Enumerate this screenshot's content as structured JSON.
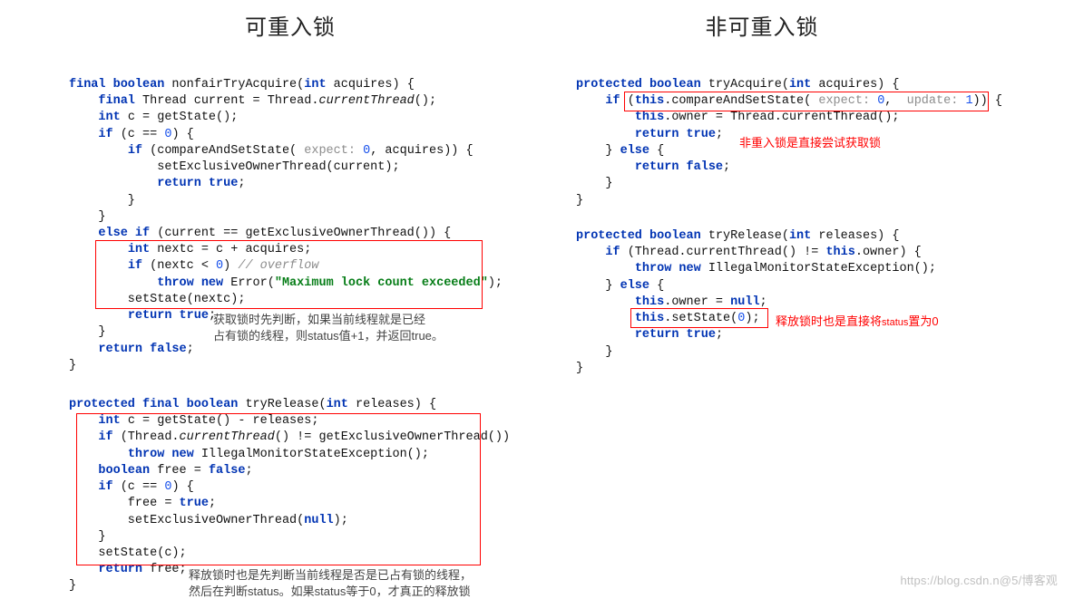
{
  "headings": {
    "left": "可重入锁",
    "right": "非可重入锁"
  },
  "left_block1_lines": [
    [
      [
        "kw",
        "final boolean"
      ],
      [
        "",
        " nonfairTryAcquire("
      ],
      [
        "kw",
        "int"
      ],
      [
        "",
        " acquires) {"
      ]
    ],
    [
      [
        "",
        "    "
      ],
      [
        "kw",
        "final"
      ],
      [
        "",
        " Thread current = Thread."
      ],
      [
        "mth",
        "currentThread"
      ],
      [
        "",
        "();"
      ]
    ],
    [
      [
        "",
        "    "
      ],
      [
        "kw",
        "int"
      ],
      [
        "",
        " c = getState();"
      ]
    ],
    [
      [
        "",
        "    "
      ],
      [
        "kw",
        "if"
      ],
      [
        "",
        " (c == "
      ],
      [
        "num",
        "0"
      ],
      [
        "",
        ") {"
      ]
    ],
    [
      [
        "",
        "        "
      ],
      [
        "kw",
        "if"
      ],
      [
        "",
        " (compareAndSetState( "
      ],
      [
        "hint",
        "expect:"
      ],
      [
        "",
        " "
      ],
      [
        "num",
        "0"
      ],
      [
        "",
        ", acquires)) {"
      ]
    ],
    [
      [
        "",
        "            setExclusiveOwnerThread(current);"
      ]
    ],
    [
      [
        "",
        "            "
      ],
      [
        "kw",
        "return true"
      ],
      [
        "",
        ";"
      ]
    ],
    [
      [
        "",
        "        }"
      ]
    ],
    [
      [
        "",
        "    }"
      ]
    ],
    [
      [
        "",
        "    "
      ],
      [
        "kw",
        "else if"
      ],
      [
        "",
        " (current == getExclusiveOwnerThread()) {"
      ]
    ],
    [
      [
        "",
        "        "
      ],
      [
        "kw",
        "int"
      ],
      [
        "",
        " nextc = c + acquires;"
      ]
    ],
    [
      [
        "",
        "        "
      ],
      [
        "kw",
        "if"
      ],
      [
        "",
        " (nextc < "
      ],
      [
        "num",
        "0"
      ],
      [
        "",
        ") "
      ],
      [
        "cm",
        "// overflow"
      ]
    ],
    [
      [
        "",
        "            "
      ],
      [
        "kw",
        "throw new"
      ],
      [
        "",
        " Error("
      ],
      [
        "str",
        "\"Maximum lock count exceeded\""
      ],
      [
        "",
        ");"
      ]
    ],
    [
      [
        "",
        "        setState(nextc);"
      ]
    ],
    [
      [
        "",
        "        "
      ],
      [
        "kw",
        "return true"
      ],
      [
        "",
        ";"
      ]
    ],
    [
      [
        "",
        "    }"
      ]
    ],
    [
      [
        "",
        "    "
      ],
      [
        "kw",
        "return false"
      ],
      [
        "",
        ";"
      ]
    ],
    [
      [
        "",
        "}"
      ]
    ]
  ],
  "left_block2_lines": [
    [
      [
        "kw",
        "protected final boolean"
      ],
      [
        "",
        " tryRelease("
      ],
      [
        "kw",
        "int"
      ],
      [
        "",
        " releases) {"
      ]
    ],
    [
      [
        "",
        "    "
      ],
      [
        "kw",
        "int"
      ],
      [
        "",
        " c = getState() - releases;"
      ]
    ],
    [
      [
        "",
        "    "
      ],
      [
        "kw",
        "if"
      ],
      [
        "",
        " (Thread."
      ],
      [
        "mth",
        "currentThread"
      ],
      [
        "",
        "() != getExclusiveOwnerThread())"
      ]
    ],
    [
      [
        "",
        "        "
      ],
      [
        "kw",
        "throw new"
      ],
      [
        "",
        " IllegalMonitorStateException();"
      ]
    ],
    [
      [
        "",
        "    "
      ],
      [
        "kw",
        "boolean"
      ],
      [
        "",
        " free = "
      ],
      [
        "kw",
        "false"
      ],
      [
        "",
        ";"
      ]
    ],
    [
      [
        "",
        "    "
      ],
      [
        "kw",
        "if"
      ],
      [
        "",
        " (c == "
      ],
      [
        "num",
        "0"
      ],
      [
        "",
        ") {"
      ]
    ],
    [
      [
        "",
        "        free = "
      ],
      [
        "kw",
        "true"
      ],
      [
        "",
        ";"
      ]
    ],
    [
      [
        "",
        "        setExclusiveOwnerThread("
      ],
      [
        "kw",
        "null"
      ],
      [
        "",
        ");"
      ]
    ],
    [
      [
        "",
        "    }"
      ]
    ],
    [
      [
        "",
        "    setState(c);"
      ]
    ],
    [
      [
        "",
        "    "
      ],
      [
        "kw",
        "return"
      ],
      [
        "",
        " free;"
      ]
    ],
    [
      [
        "",
        "}"
      ]
    ]
  ],
  "right_block1_lines": [
    [
      [
        "kw",
        "protected boolean"
      ],
      [
        "",
        " tryAcquire("
      ],
      [
        "kw",
        "int"
      ],
      [
        "",
        " acquires) {"
      ]
    ],
    [
      [
        "",
        "    "
      ],
      [
        "kw",
        "if"
      ],
      [
        "",
        " ("
      ],
      [
        "kw",
        "this"
      ],
      [
        "",
        ".compareAndSetState( "
      ],
      [
        "hint",
        "expect:"
      ],
      [
        "",
        " "
      ],
      [
        "num",
        "0"
      ],
      [
        "",
        ",  "
      ],
      [
        "hint",
        "update:"
      ],
      [
        "",
        " "
      ],
      [
        "num",
        "1"
      ],
      [
        "",
        ")) {"
      ]
    ],
    [
      [
        "",
        "        "
      ],
      [
        "kw",
        "this"
      ],
      [
        "",
        ".owner = Thread.currentThread();"
      ]
    ],
    [
      [
        "",
        "        "
      ],
      [
        "kw",
        "return true"
      ],
      [
        "",
        ";"
      ]
    ],
    [
      [
        "",
        "    } "
      ],
      [
        "kw",
        "else"
      ],
      [
        "",
        " {"
      ]
    ],
    [
      [
        "",
        "        "
      ],
      [
        "kw",
        "return false"
      ],
      [
        "",
        ";"
      ]
    ],
    [
      [
        "",
        "    }"
      ]
    ],
    [
      [
        "",
        "}"
      ]
    ]
  ],
  "right_block2_lines": [
    [
      [
        "kw",
        "protected boolean"
      ],
      [
        "",
        " tryRelease("
      ],
      [
        "kw",
        "int"
      ],
      [
        "",
        " releases) {"
      ]
    ],
    [
      [
        "",
        "    "
      ],
      [
        "kw",
        "if"
      ],
      [
        "",
        " (Thread.currentThread() != "
      ],
      [
        "kw",
        "this"
      ],
      [
        "",
        ".owner) {"
      ]
    ],
    [
      [
        "",
        "        "
      ],
      [
        "kw",
        "throw new"
      ],
      [
        "",
        " IllegalMonitorStateException();"
      ]
    ],
    [
      [
        "",
        "    } "
      ],
      [
        "kw",
        "else"
      ],
      [
        "",
        " {"
      ]
    ],
    [
      [
        "",
        "        "
      ],
      [
        "kw",
        "this"
      ],
      [
        "",
        ".owner = "
      ],
      [
        "kw",
        "null"
      ],
      [
        "",
        ";"
      ]
    ],
    [
      [
        "",
        "        "
      ],
      [
        "kw",
        "this"
      ],
      [
        "",
        ".setState("
      ],
      [
        "num",
        "0"
      ],
      [
        "",
        ");"
      ]
    ],
    [
      [
        "",
        "        "
      ],
      [
        "kw",
        "return true"
      ],
      [
        "",
        ";"
      ]
    ],
    [
      [
        "",
        "    }"
      ]
    ],
    [
      [
        "",
        "}"
      ]
    ]
  ],
  "annotations": {
    "left1_line1": "获取锁时先判断，如果当前线程就是已经",
    "left1_line2": "占有锁的线程，则status值+1，并返回true。",
    "left2_line1": "释放锁时也是先判断当前线程是否是已占有锁的线程，",
    "left2_line2": "然后在判断status。如果status等于0，才真正的释放锁",
    "right1": "非重入锁是直接尝试获取锁",
    "right2_prefix": "释放锁时也是直接将",
    "right2_suffix": "置为0"
  },
  "watermark": "https://blog.csdn.n@5/博客观"
}
